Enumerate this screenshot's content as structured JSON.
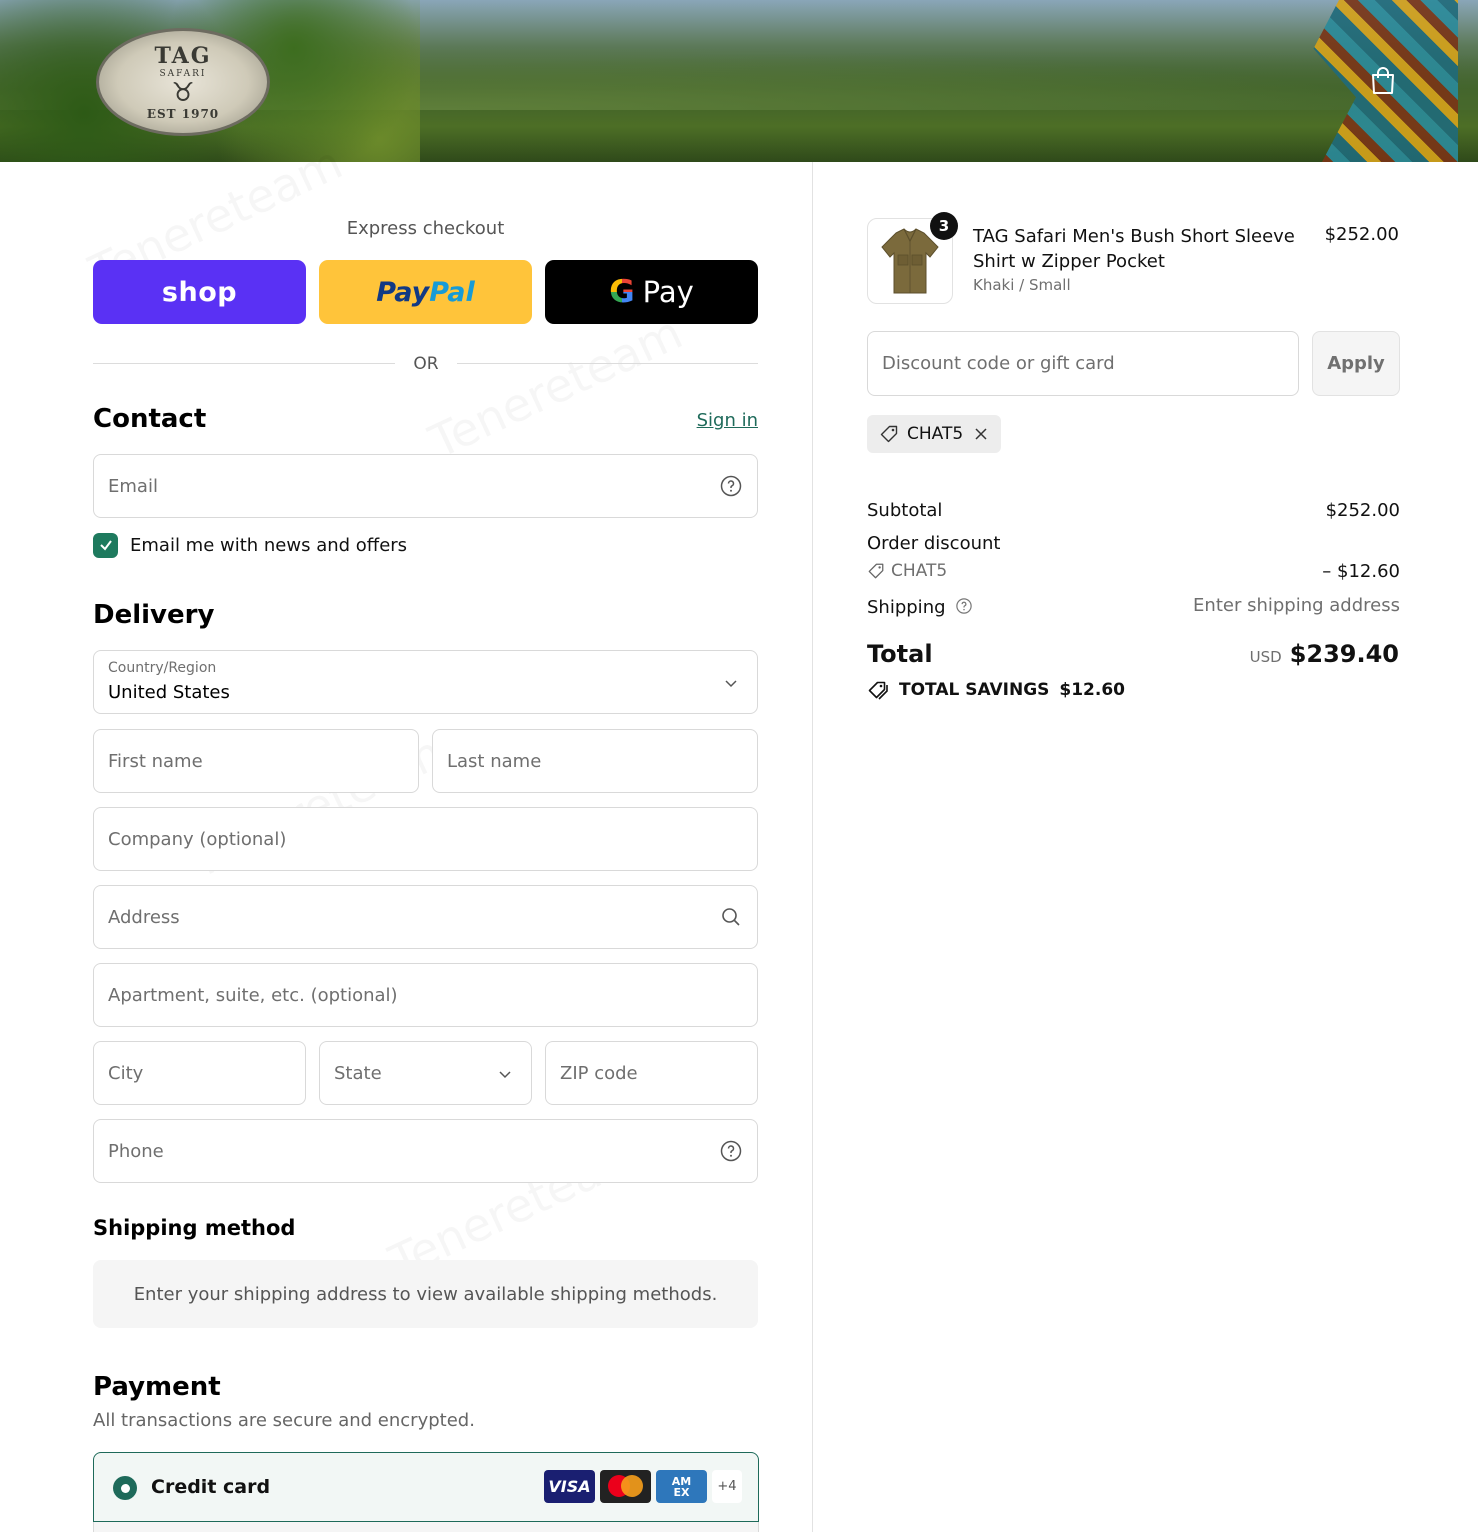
{
  "header": {
    "logo": {
      "top": "TAG",
      "middle": "SAFARI",
      "bottom": "EST 1970"
    },
    "cart_icon": "shopping-bag-icon"
  },
  "express": {
    "title": "Express checkout",
    "shop_label": "shop",
    "paypal_label_1": "Pay",
    "paypal_label_2": "Pal",
    "gpay_g": "G",
    "gpay_label": "Pay",
    "or_label": "OR"
  },
  "contact": {
    "title": "Contact",
    "signin": "Sign in",
    "email_placeholder": "Email",
    "newsletter_label": "Email me with news and offers",
    "newsletter_checked": true
  },
  "delivery": {
    "title": "Delivery",
    "country_label": "Country/Region",
    "country_value": "United States",
    "first_name_placeholder": "First name",
    "last_name_placeholder": "Last name",
    "company_placeholder": "Company (optional)",
    "address_placeholder": "Address",
    "apartment_placeholder": "Apartment, suite, etc. (optional)",
    "city_placeholder": "City",
    "state_placeholder": "State",
    "zip_placeholder": "ZIP code",
    "phone_placeholder": "Phone"
  },
  "shipping_method": {
    "title": "Shipping method",
    "message": "Enter your shipping address to view available shipping methods."
  },
  "payment": {
    "title": "Payment",
    "subtitle": "All transactions are secure and encrypted.",
    "credit_card_label": "Credit card",
    "card_visa": "VISA",
    "card_amex_1": "AM",
    "card_amex_2": "EX",
    "card_more": "+4"
  },
  "summary": {
    "item": {
      "quantity": "3",
      "title": "TAG Safari Men's Bush Short Sleeve Shirt w Zipper Pocket",
      "variant": "Khaki / Small",
      "price": "$252.00"
    },
    "discount_placeholder": "Discount code or gift card",
    "apply_label": "Apply",
    "applied_code": "CHAT5",
    "subtotal_label": "Subtotal",
    "subtotal_value": "$252.00",
    "order_discount_label": "Order discount",
    "order_discount_code": "CHAT5",
    "order_discount_value": "– $12.60",
    "shipping_label": "Shipping",
    "shipping_value": "Enter shipping address",
    "total_label": "Total",
    "total_currency": "USD",
    "total_value": "$239.40",
    "savings_label": "TOTAL SAVINGS",
    "savings_value": "$12.60"
  },
  "colors": {
    "accent": "#1e6a5a",
    "shop_pay": "#5a31f4",
    "paypal": "#ffc43a"
  }
}
